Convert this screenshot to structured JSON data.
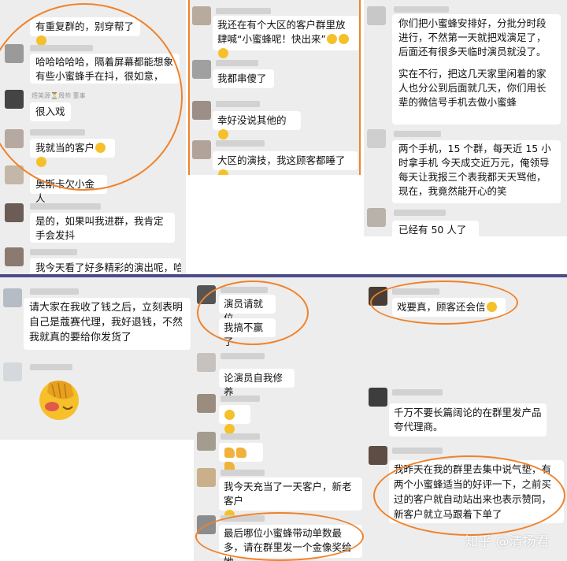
{
  "screenshot": {
    "panel_top_left": {
      "messages": [
        "有重复群的，别穿帮了",
        "哈哈哈哈哈，隔着屏幕都能想象有些小蜜蜂手在抖，很如意，",
        "很入戏",
        "我就当的客户",
        "奥斯卡欠小金人",
        "是的，如果叫我进群，我肯定手会发抖",
        "我今天看了好多精彩的演出呢，哈"
      ],
      "sender_title": "煜美源⏳周帅 董事"
    },
    "panel_top_mid": {
      "messages": [
        "我还在有个大区的客户群里放肆喊“小蜜蜂呢！快出来”",
        "我都串傻了",
        "幸好没说其他的",
        "大区的演技，我这顾客都睡了"
      ]
    },
    "panel_top_right": {
      "messages": [
        "你们把小蜜蜂安排好，分批分时段进行，不然第一天就把戏演足了，后面还有很多天临时演员就没了。",
        "实在不行，把这几天家里闲着的家人也分公到后面就几天，你们用长辈的微信号手机去做小蜜蜂",
        "两个手机，15 个群，每天近 15 小时拿手机 今天成交近万元，俺领导每天让我报三个表我都天天骂他，现在，我竟然能开心的笑",
        "已经有 50 人了"
      ]
    },
    "panel_bottom_left": {
      "messages": [
        "请大家在我收了钱之后，立刻表明自己是蔻赛代理，我好退钱，不然我就真的要给你发货了"
      ]
    },
    "panel_bottom_mid": {
      "messages": [
        "演员请就位",
        "我搞不赢了",
        "论演员自我修养",
        "我今天充当了一天客户，新老客户",
        "最后哪位小蜜蜂带动单数最多，请在群里发一个金像奖给她"
      ]
    },
    "panel_bottom_right": {
      "messages": [
        "戏要真，顾客还会信",
        "千万不要长篇阔论的在群里发产品夸代理商。",
        "我昨天在我的群里去集中说气垫，有两个小蜜蜂适当的好评一下，之前买过的客户就自动站出来也表示赞同，新客户就立马跟着下单了"
      ]
    },
    "watermark": "知乎 @清扬君"
  },
  "colors": {
    "chat_bg": "#ededed",
    "bubble_bg": "#ffffff",
    "highlight_ring": "#f0822a",
    "divider": "#4b4d86"
  },
  "icons": [
    "avatar-placeholder",
    "emoji-icon",
    "thumbs-up-icon",
    "facepalm-sticker"
  ]
}
